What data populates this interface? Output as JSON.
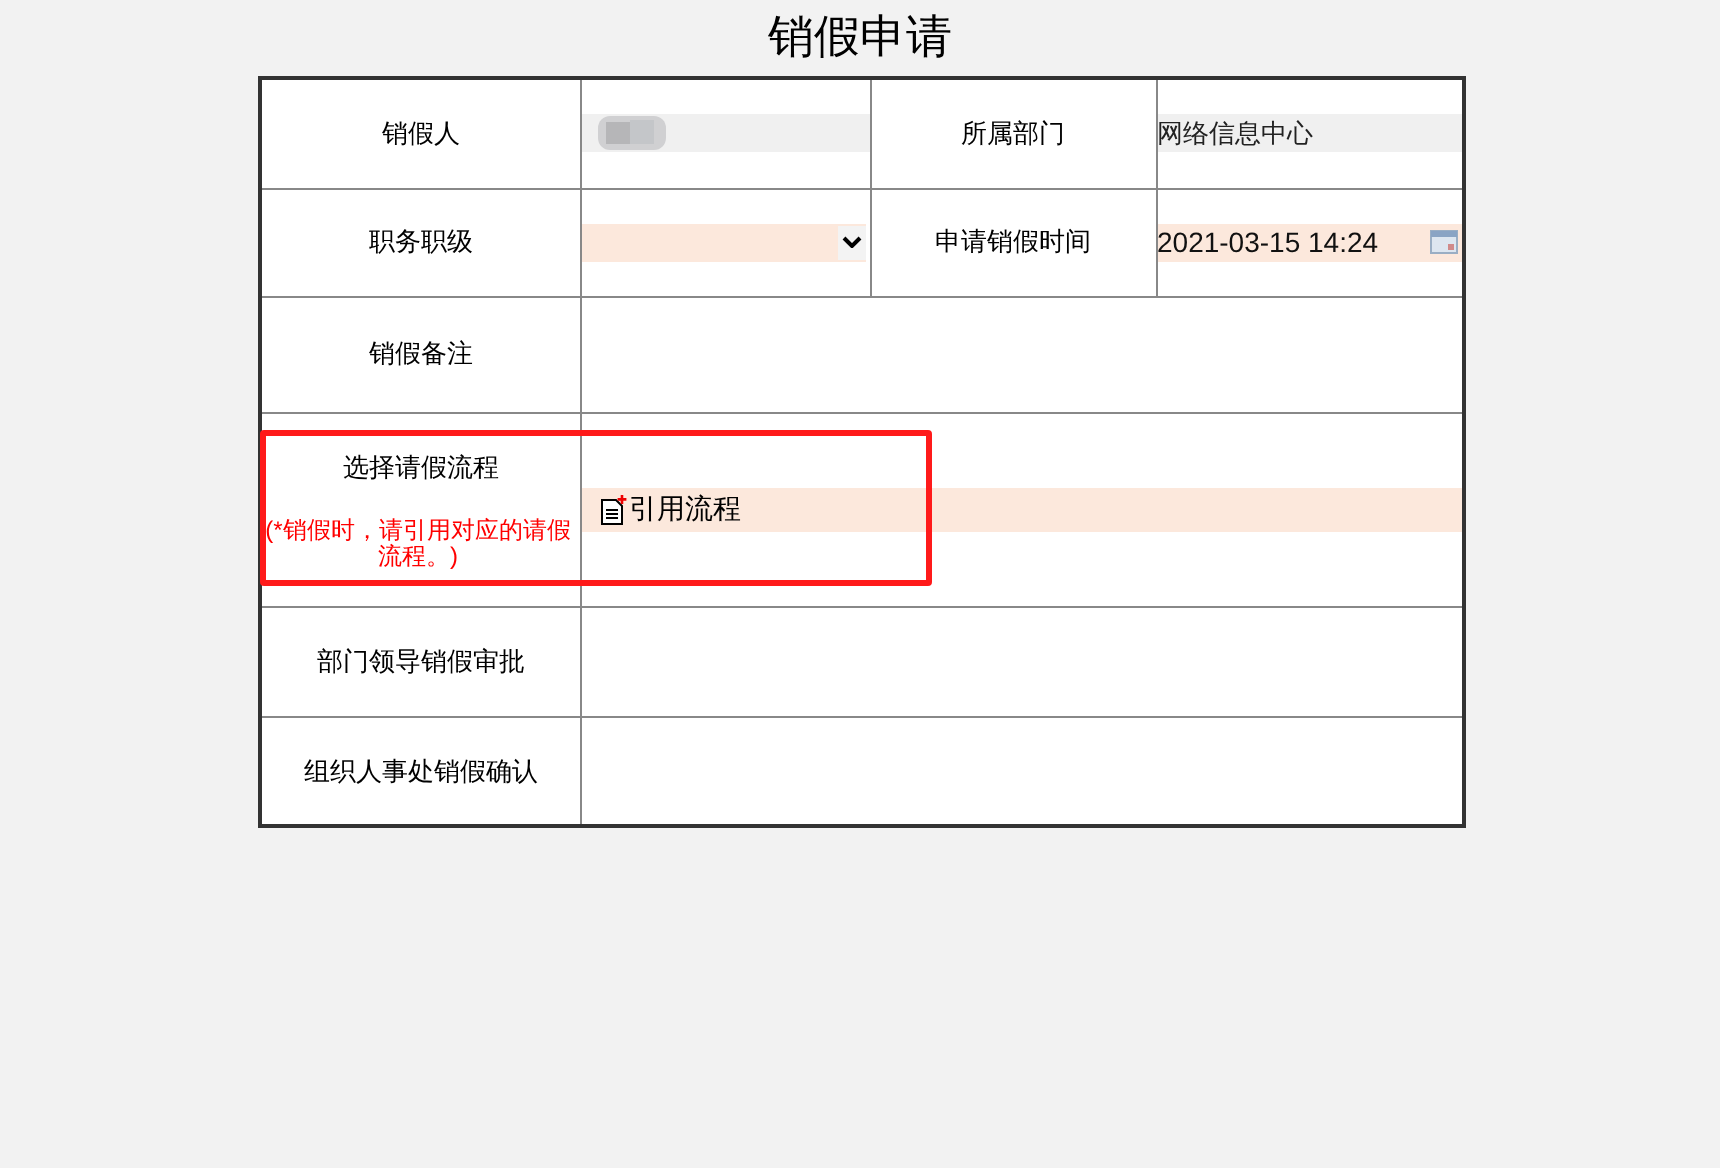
{
  "title": "销假申请",
  "rows": [
    {
      "label": "销假人",
      "field": {
        "kind": "redacted"
      },
      "label_2": "所属部门",
      "field_2": {
        "kind": "readonly",
        "value": "网络信息中心"
      }
    },
    {
      "label": "职务职级",
      "field": {
        "kind": "select"
      },
      "label_2": "申请销假时间",
      "field_2": {
        "kind": "date",
        "value": "2021-03-15 14:24"
      }
    },
    {
      "label": "销假备注",
      "field": {
        "kind": "empty"
      }
    },
    {
      "label": "选择请假流程",
      "note": "(*销假时，请引用对应的请假流程。)",
      "highlighted": true,
      "field": {
        "kind": "link",
        "value": "引用流程"
      }
    },
    {
      "label": "部门领导销假审批",
      "field": {
        "kind": "empty"
      }
    },
    {
      "label": "组织人事处销假确认",
      "field": {
        "kind": "empty"
      }
    }
  ]
}
